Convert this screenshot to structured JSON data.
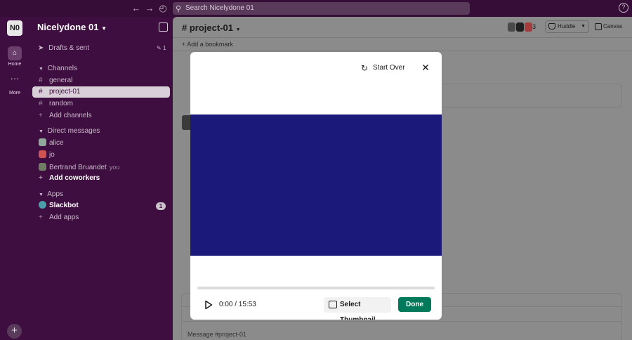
{
  "top_bar": {
    "search_placeholder": "Search Nicelydone 01",
    "help_glyph": "?"
  },
  "rail": {
    "workspace_badge": "N0",
    "home_label": "Home",
    "more_label": "More"
  },
  "sidebar": {
    "workspace_name": "Nicelydone 01",
    "drafts_label": "Drafts & sent",
    "drafts_count": "1",
    "channels_header": "Channels",
    "channels": [
      "general",
      "project-01",
      "random"
    ],
    "add_channels": "Add channels",
    "dm_header": "Direct messages",
    "dms": [
      "alice",
      "jo",
      "Bertrand Bruandet"
    ],
    "you_label": "you",
    "add_coworkers": "Add coworkers",
    "apps_header": "Apps",
    "slackbot": "Slackbot",
    "slackbot_badge": "1",
    "add_apps": "Add apps"
  },
  "channel": {
    "title": "# project-01",
    "bookmark": "Add a bookmark",
    "member_count": "3",
    "huddle": "Huddle",
    "canvas": "Canvas",
    "composer_placeholder": "Message #project-01"
  },
  "modal": {
    "start_over": "Start Over",
    "time": "0:00 / 15:53",
    "select_thumbnail": "Select Thumbnail",
    "done": "Done"
  },
  "colors": {
    "sidebar_bg": "#3f0e40",
    "video_frame": "#1b197a",
    "done_button": "#007a5a"
  }
}
